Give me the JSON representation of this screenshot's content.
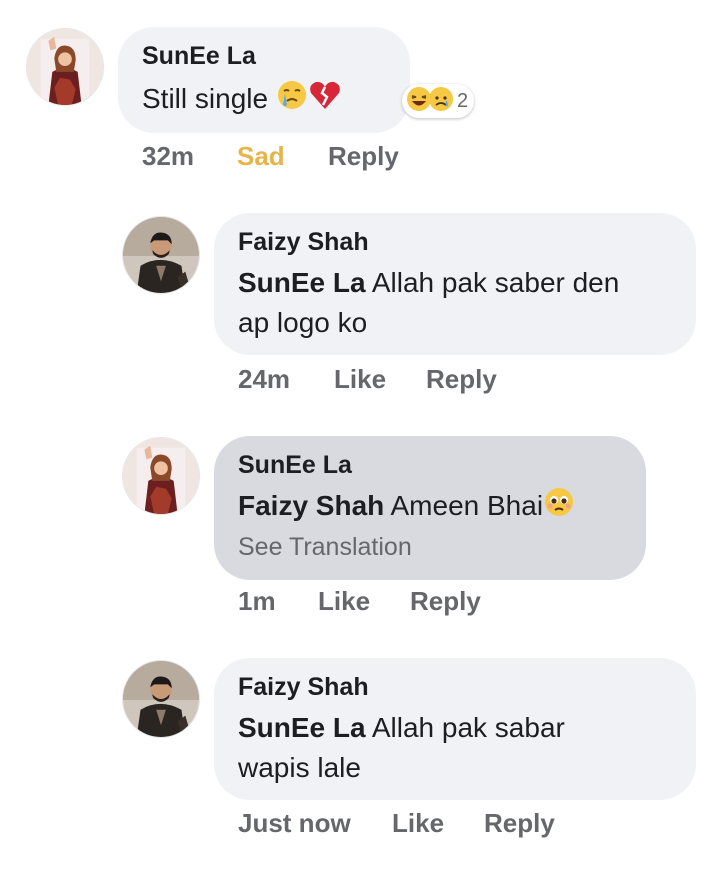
{
  "comments": [
    {
      "author": "SunEe La",
      "text": "Still single",
      "time": "32m",
      "reaction_label": "Sad",
      "reply": "Reply",
      "reaction_count": "2"
    },
    {
      "author": "Faizy Shah",
      "mention": "SunEe La",
      "text_line1": "Allah pak saber den",
      "text_line2": "ap logo ko",
      "time": "24m",
      "like": "Like",
      "reply": "Reply"
    },
    {
      "author": "SunEe La",
      "mention": "Faizy Shah",
      "text": "Ameen Bhai",
      "see_translation": "See Translation",
      "time": "1m",
      "like": "Like",
      "reply": "Reply"
    },
    {
      "author": "Faizy Shah",
      "mention": "SunEe La",
      "text_line1": "Allah pak sabar",
      "text_line2": "wapis lale",
      "time": "Just now",
      "like": "Like",
      "reply": "Reply"
    }
  ],
  "icons": {
    "crying": "crying-face-emoji",
    "broken_heart": "broken-heart-emoji",
    "laugh": "laughing-reaction-icon",
    "sad": "sad-reaction-icon",
    "pleading": "pleading-face-emoji"
  },
  "colors": {
    "bubble": "#f0f2f5",
    "bubble_highlight": "#d8dadf",
    "meta_text": "#65676b",
    "sad_reaction": "#e6b54a"
  }
}
